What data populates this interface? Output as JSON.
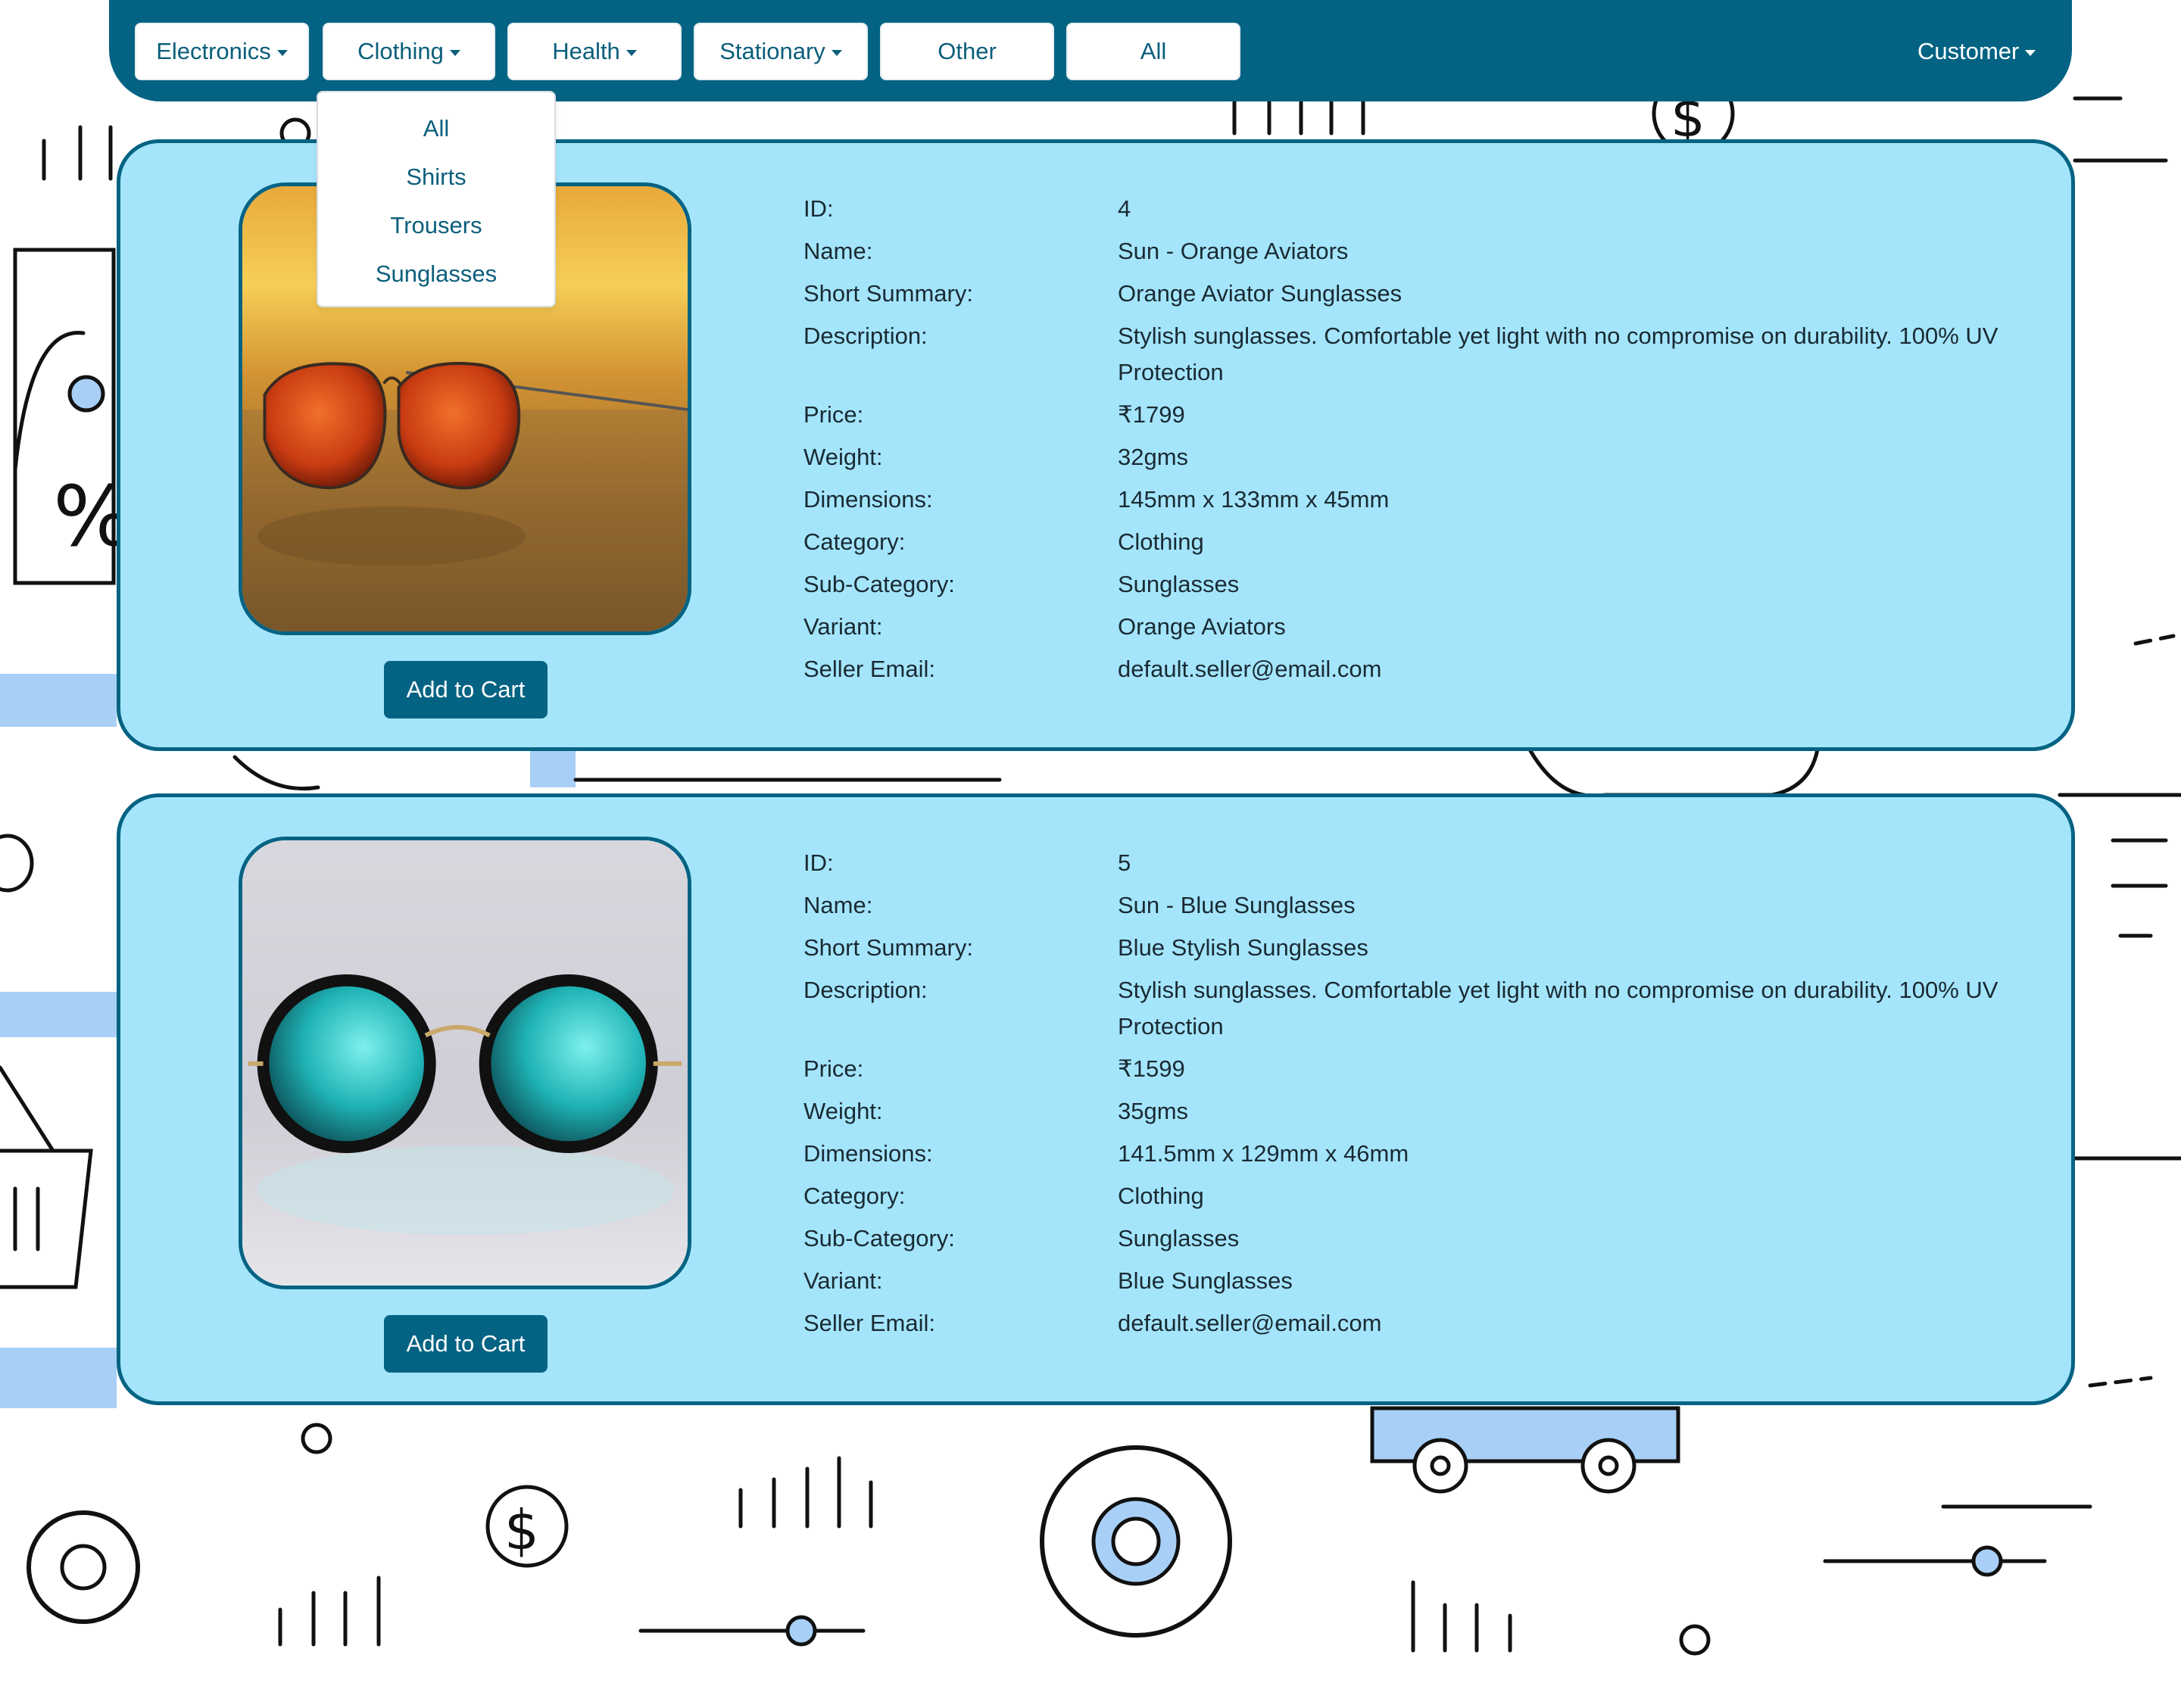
{
  "navbar": {
    "menus": [
      {
        "label": "Electronics",
        "caret": true
      },
      {
        "label": "Clothing",
        "caret": true
      },
      {
        "label": "Health",
        "caret": true
      },
      {
        "label": "Stationary",
        "caret": true
      },
      {
        "label": "Other",
        "caret": false
      },
      {
        "label": "All",
        "caret": false
      }
    ],
    "user_menu": "Customer",
    "cart_icon": "shopping-cart-icon",
    "colors": {
      "bar": "#046383",
      "button_text": "#0b5e7c"
    }
  },
  "clothing_dropdown": {
    "items": [
      "All",
      "Shirts",
      "Trousers",
      "Sunglasses"
    ]
  },
  "field_labels": {
    "id": "ID:",
    "name": "Name:",
    "short_summary": "Short Summary:",
    "description": "Description:",
    "price": "Price:",
    "weight": "Weight:",
    "dimensions": "Dimensions:",
    "category": "Category:",
    "sub_category": "Sub-Category:",
    "variant": "Variant:",
    "seller_email": "Seller Email:"
  },
  "products": [
    {
      "id": "4",
      "name": "Sun - Orange Aviators",
      "short_summary": "Orange Aviator Sunglasses",
      "description": "Stylish sunglasses. Comfortable yet light with no compromise on durability. 100% UV Protection",
      "price": "₹1799",
      "weight": "32gms",
      "dimensions": "145mm x 133mm x 45mm",
      "category": "Clothing",
      "sub_category": "Sunglasses",
      "variant": "Orange Aviators",
      "seller_email": "default.seller@email.com",
      "button": "Add to Cart",
      "image": "orange-aviator-sunglasses-photo"
    },
    {
      "id": "5",
      "name": "Sun - Blue Sunglasses",
      "short_summary": "Blue Stylish Sunglasses",
      "description": "Stylish sunglasses. Comfortable yet light with no compromise on durability. 100% UV Protection",
      "price": "₹1599",
      "weight": "35gms",
      "dimensions": "141.5mm x 129mm x 46mm",
      "category": "Clothing",
      "sub_category": "Sunglasses",
      "variant": "Blue Sunglasses",
      "seller_email": "default.seller@email.com",
      "button": "Add to Cart",
      "image": "blue-round-sunglasses-photo"
    }
  ],
  "card_colors": {
    "background": "#a4e5fc",
    "border": "#046383"
  }
}
